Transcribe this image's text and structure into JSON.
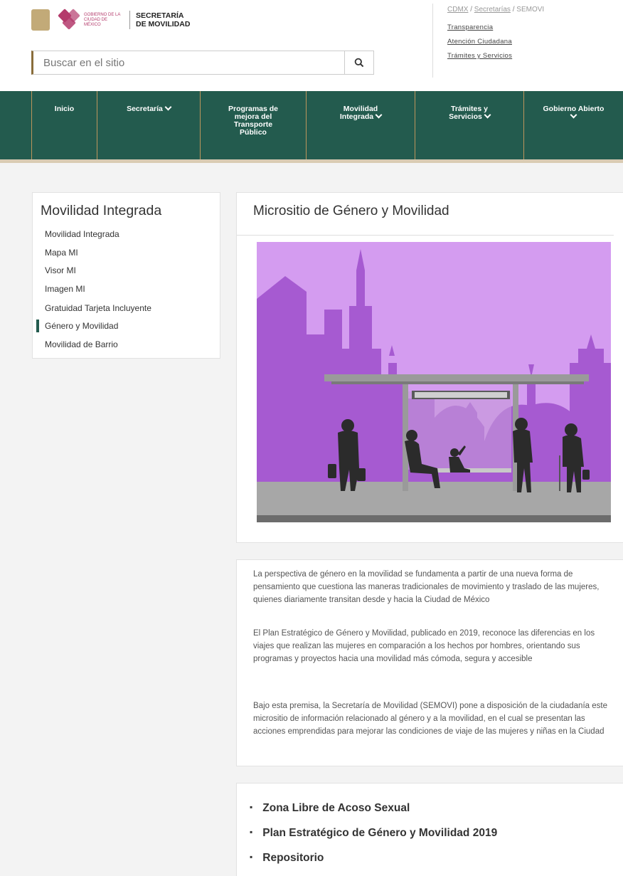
{
  "header": {
    "cdmx_small_text": "GOBIERNO DE LA CIUDAD DE MÉXICO",
    "secretaria_line1": "SECRETARÍA",
    "secretaria_line2": "DE MOVILIDAD",
    "search_placeholder": "Buscar en el sitio",
    "breadcrumb": {
      "item1": "CDMX",
      "sep1": " / ",
      "item2": "Secretarías",
      "sep2": " / ",
      "current": "SEMOVI"
    },
    "links": [
      "Transparencia",
      "Atención Ciudadana",
      "Trámites y Servicios"
    ]
  },
  "nav": {
    "items": [
      {
        "label": "Inicio"
      },
      {
        "label": "Secretaría"
      },
      {
        "line1": "Programas de",
        "line2": "mejora del",
        "line3": "Transporte",
        "line4": "Público"
      },
      {
        "line1": "Movilidad",
        "line2": "Integrada"
      },
      {
        "line1": "Trámites y",
        "line2": "Servicios"
      },
      {
        "label": "Gobierno Abierto"
      }
    ]
  },
  "sidebar": {
    "title": "Movilidad Integrada",
    "items": [
      "Movilidad Integrada",
      "Mapa MI",
      "Visor MI",
      "Imagen MI",
      "Gratuidad Tarjeta Incluyente",
      "Género y Movilidad",
      "Movilidad de Barrio"
    ],
    "active_index": 5
  },
  "main": {
    "title": "Micrositio de Género y Movilidad",
    "paragraphs": [
      "La perspectiva de género en la movilidad se fundamenta a partir de una nueva forma de pensamiento que cuestiona las maneras tradicionales de movimiento y traslado de las mujeres, quienes diariamente transitan desde y hacia la Ciudad de México",
      "El Plan Estratégico de Género y Movilidad, publicado en  2019, reconoce las diferencias en los viajes que realizan las mujeres en comparación a los hechos por hombres, orientando sus programas y proyectos hacia una movilidad más cómoda, segura y accesible",
      "Bajo esta premisa, la Secretaría de Movilidad (SEMOVI) pone a disposición de la ciudadanía este micrositio de información relacionado al género y a la movilidad, en el cual se presentan las acciones emprendidas para mejorar las condiciones de viaje de las mujeres y niñas en la Ciudad"
    ],
    "links": [
      "Zona Libre de Acoso Sexual",
      "Plan Estratégico de Género y Movilidad 2019",
      "Repositorio"
    ],
    "bullet": "▪"
  },
  "colors": {
    "nav_green": "#235b4e",
    "gold": "#bc955c",
    "purple_sky": "#d49cf0",
    "purple_city": "#9a50c4"
  },
  "icons": {
    "search": "search-icon",
    "chevron": "chevron-down-icon"
  }
}
